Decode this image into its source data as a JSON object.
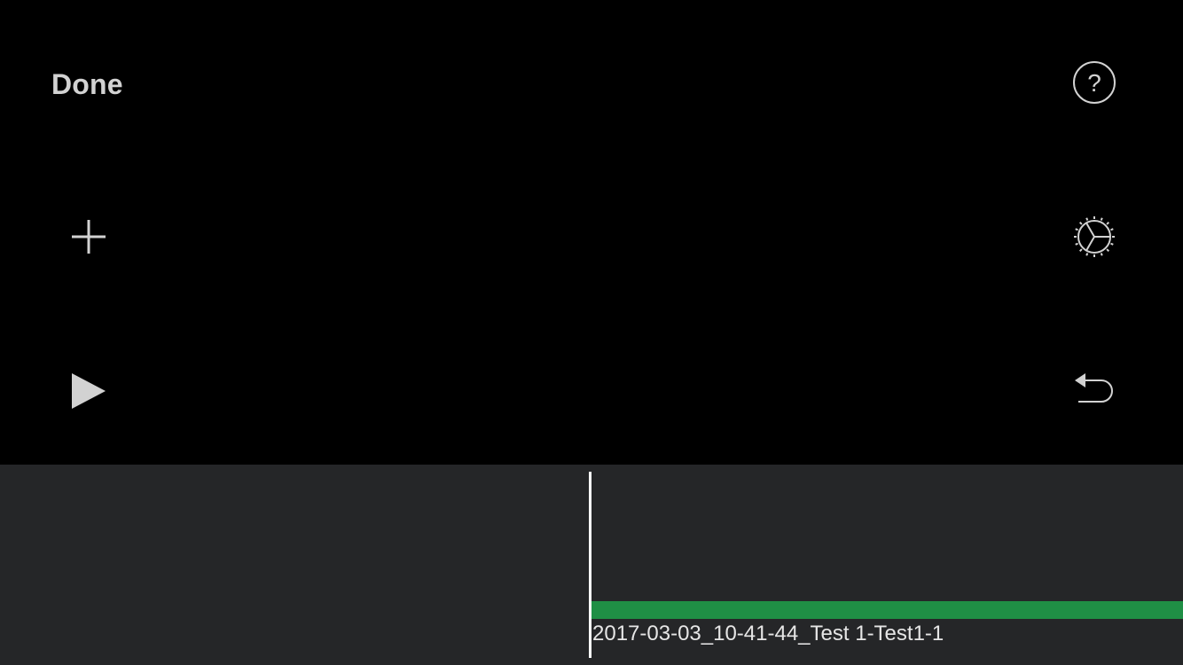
{
  "toolbar": {
    "done_label": "Done"
  },
  "icons": {
    "add": "plus-icon",
    "play": "play-icon",
    "help": "help-icon",
    "settings": "gear-icon",
    "undo": "undo-icon",
    "help_glyph": "?"
  },
  "timeline": {
    "clip_title": "2017-03-03_10-41-44_Test 1-Test1-1",
    "clip_color": "#1f8f45"
  },
  "colors": {
    "background": "#000000",
    "timeline_background": "#252628",
    "icon": "#d2d2d2"
  }
}
